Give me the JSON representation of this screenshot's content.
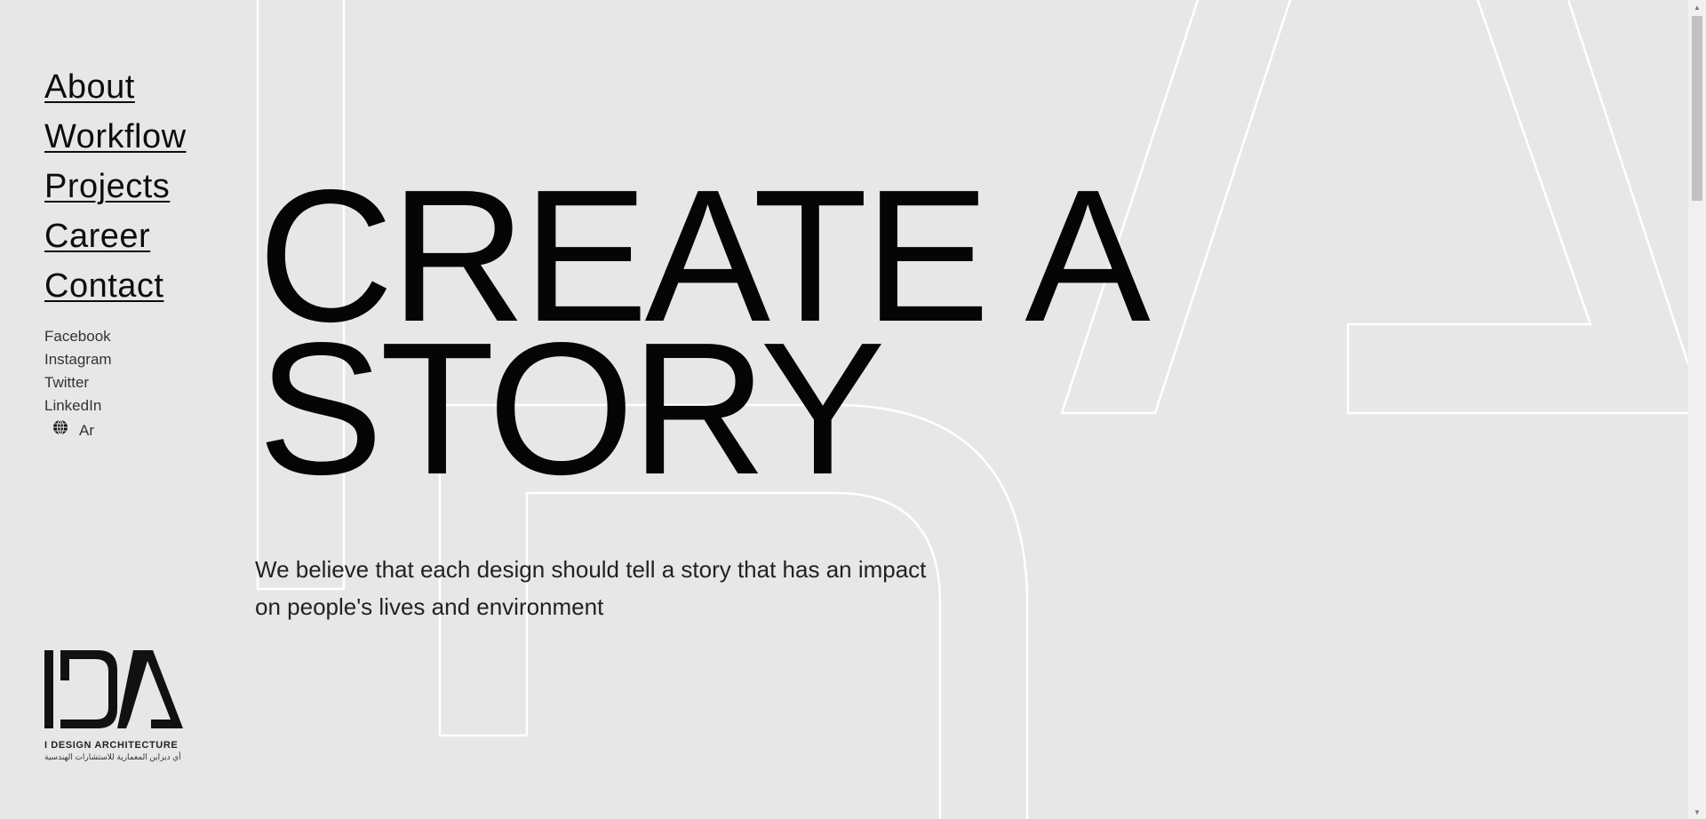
{
  "nav": {
    "items": [
      {
        "label": "About"
      },
      {
        "label": "Workflow"
      },
      {
        "label": "Projects"
      },
      {
        "label": "Career"
      },
      {
        "label": "Contact"
      }
    ]
  },
  "social": {
    "items": [
      {
        "label": "Facebook"
      },
      {
        "label": "Instagram"
      },
      {
        "label": "Twitter"
      },
      {
        "label": "LinkedIn"
      }
    ],
    "language": {
      "icon": "globe-icon",
      "label": "Ar"
    }
  },
  "hero": {
    "line1": "CREATE A",
    "line2": "STORY",
    "tagline": "We believe that each design should tell a story that has an impact on people's lives and environment"
  },
  "logo": {
    "mark": "IDA",
    "name_en": "I DESIGN ARCHITECTURE",
    "name_ar": "أي ديزاين المعمارية للاستشارات الهندسية"
  },
  "colors": {
    "background": "#e7e7e7",
    "text": "#0d0d0d",
    "outline": "#ffffff"
  }
}
